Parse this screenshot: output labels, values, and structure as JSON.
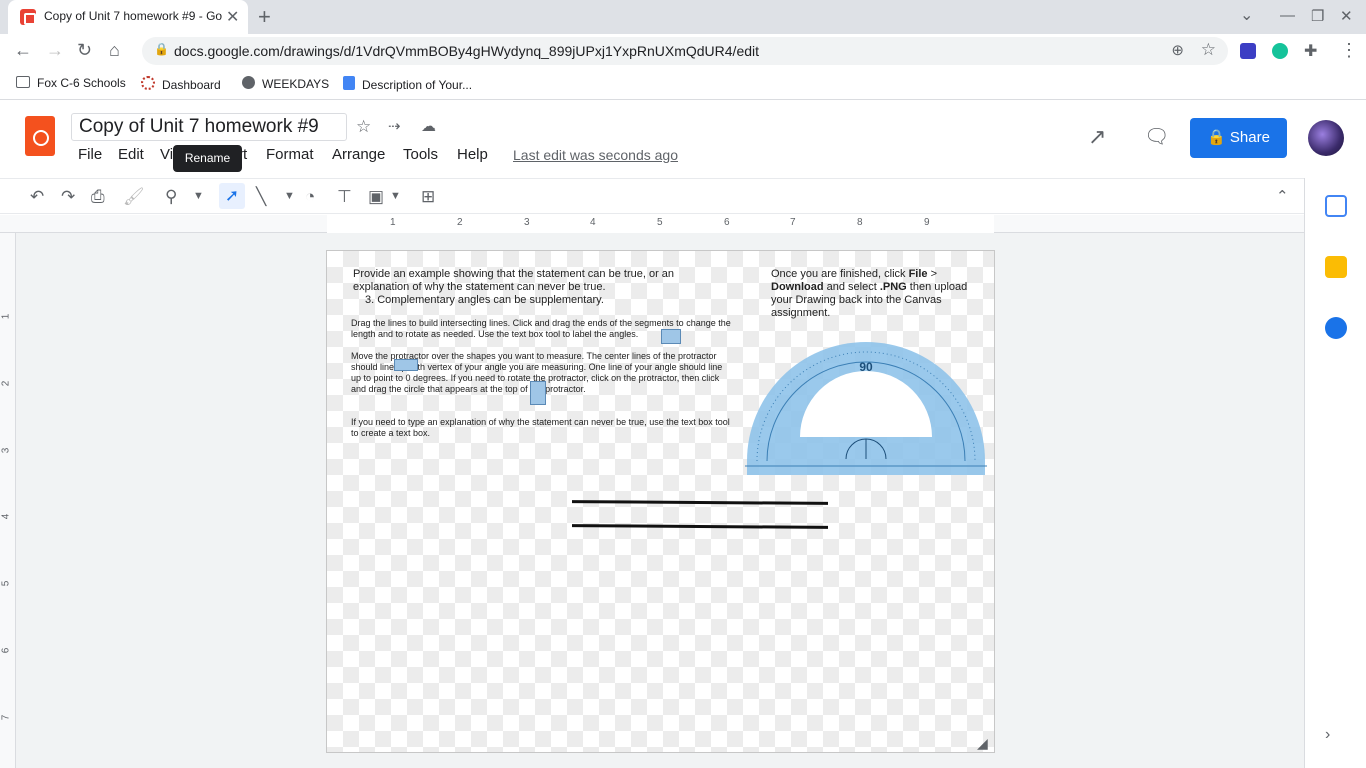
{
  "browser": {
    "tab_title": "Copy of Unit 7 homework #9 - Go",
    "new_tab": "+",
    "url": "docs.google.com/drawings/d/1VdrQVmmBOBy4gHWydynq_899jUPxj1YxpRnUXmQdUR4/edit",
    "bookmarks": [
      "Fox C-6 Schools",
      "Dashboard",
      "WEEKDAYS",
      "Description of Your..."
    ]
  },
  "app": {
    "doc_title": "Copy of Unit 7 homework #9",
    "tooltip": "Rename",
    "menus": [
      "File",
      "Edit",
      "Vi",
      "rt",
      "Format",
      "Arrange",
      "Tools",
      "Help"
    ],
    "last_edit": "Last edit was seconds ago",
    "share_label": "Share"
  },
  "ruler": {
    "h": [
      "1",
      "2",
      "3",
      "4",
      "5",
      "6",
      "7",
      "8",
      "9"
    ],
    "v": [
      "1",
      "2",
      "3",
      "4",
      "5",
      "6",
      "7"
    ]
  },
  "canvas": {
    "prompt": "Provide an example showing that the statement can be true, or an explanation of why the statement can never be true.",
    "item": "3.    Complementary angles can be supplementary.",
    "instr1": "Drag the lines to build intersecting lines. Click and drag the ends of the segments to change the length and to rotate as needed. Use the text box tool to label the angles.",
    "instr2": "Move the protractor over the shapes you want to measure. The center lines of the protractor should line up with vertex of your angle you are measuring. One line of your angle should line up to point to 0 degrees. If you need to rotate the protractor, click on the protractor, then click and drag the circle       that appears at the top of the protractor.",
    "instr3": "If you need to type an explanation of why the statement can never be true, use the text box tool to create a text box.",
    "finish_intro": "Once you are finished, click ",
    "finish_file": "File",
    "finish_gt": " > ",
    "finish_download": "Download",
    "finish_mid": " and select ",
    "finish_png": ".PNG",
    "finish_end": " then upload your Drawing back into the Canvas assignment.",
    "protractor_top": "90"
  },
  "colors": {
    "share": "#1a73e8",
    "logo": "#f4511e",
    "protractor": "#8fc3ea"
  }
}
